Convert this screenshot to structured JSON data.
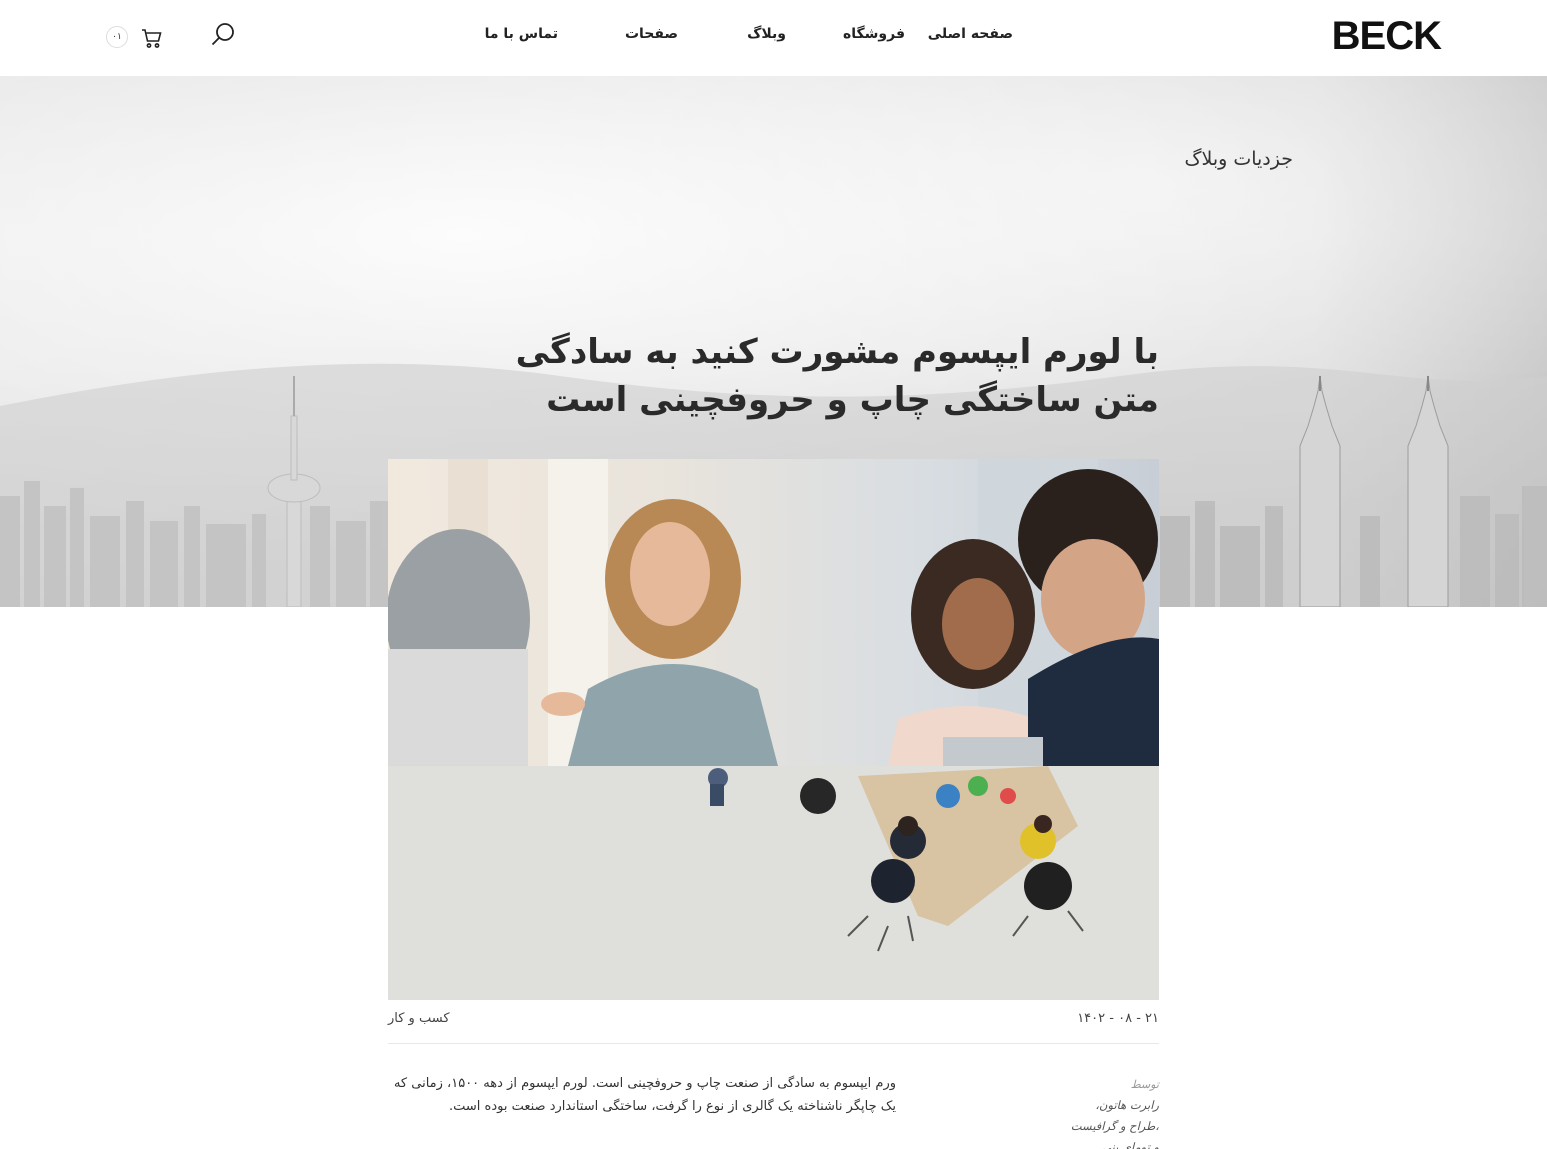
{
  "header": {
    "logo": "BECK",
    "nav": [
      {
        "label": "صفحه اصلی"
      },
      {
        "label": "فروشگاه"
      },
      {
        "label": "وبلاگ"
      },
      {
        "label": "صفحات"
      },
      {
        "label": "تماس با ما"
      }
    ],
    "cart_count": "۰۱"
  },
  "breadcrumb": "جزدیات وبلاگ",
  "post": {
    "title": "با لورم ایپسوم مشورت کنید به سادگی متن ساختگی چاپ و حروفچینی است",
    "date": "۲۱ - ۰۸ - ۱۴۰۲",
    "category": "کسب و کار",
    "author_label": "توسط",
    "author_lines": [
      "رابرت هاتون،",
      "،طراح و گرافیست",
      "و تومای بنی"
    ],
    "excerpt": "ورم ایپسوم به سادگی از صنعت چاپ و حروفچینی است. لورم ایپسوم از دهه ۱۵۰۰، زمانی که یک چاپگر ناشناخته یک گالری از نوع را گرفت، ساختگی استاندارد صنعت بوده است."
  },
  "colors": {
    "text": "#222222",
    "accent": "#111111",
    "background": "#ffffff"
  },
  "icons": [
    "search-icon",
    "cart-icon"
  ]
}
